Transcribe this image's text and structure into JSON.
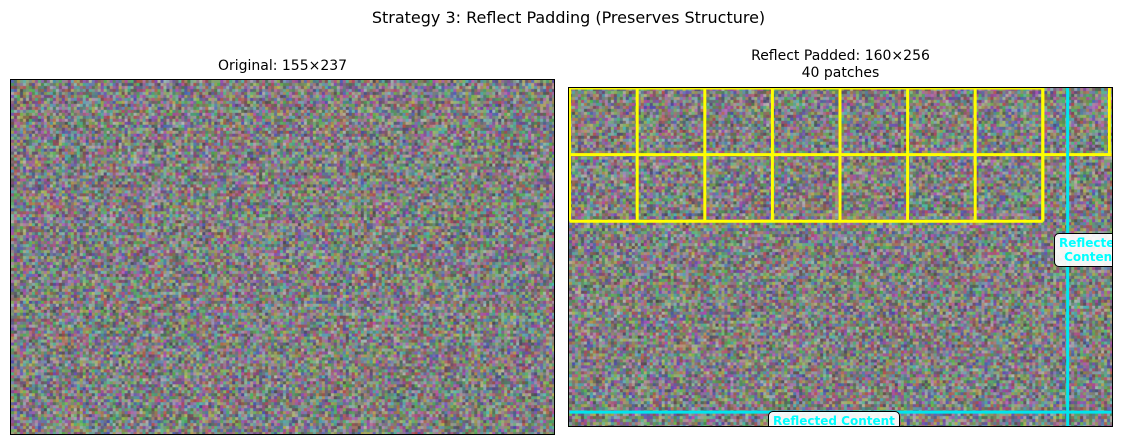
{
  "suptitle": "Strategy 3: Reflect Padding (Preserves Structure)",
  "left": {
    "title": "Original: 155×237"
  },
  "right": {
    "title_line1": "Reflect Padded: 160×256",
    "title_line2": "40 patches",
    "label_right": "Reflected\nContent",
    "label_bottom": "Reflected Content"
  },
  "colors": {
    "grid": "#ffff00",
    "reflect": "#00e5ee",
    "label_text": "#00ffff"
  }
}
